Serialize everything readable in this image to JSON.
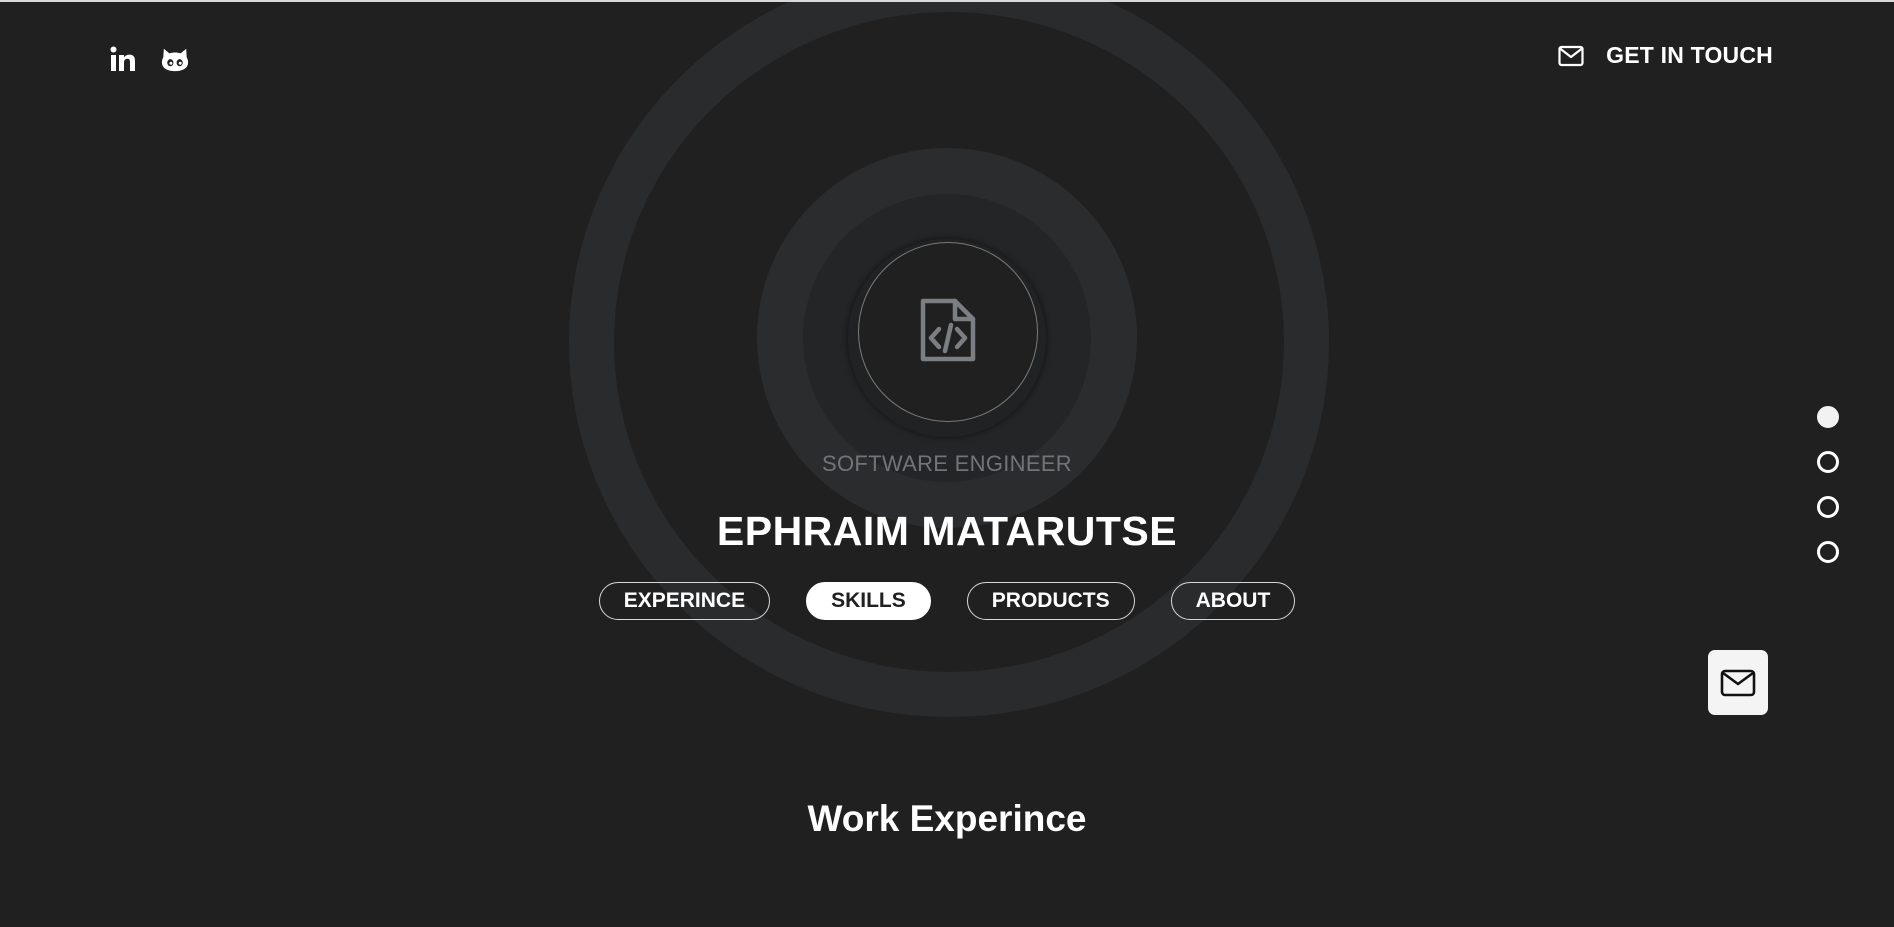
{
  "header": {
    "social_icons": [
      "linkedin-icon",
      "github-icon"
    ],
    "contact_icon": "mail-icon",
    "contact_label": "GET IN TOUCH"
  },
  "hero": {
    "avatar_icon": "code-file-icon",
    "subtitle": "SOFTWARE ENGINEER",
    "name": "EPHRAIM MATARUTSE",
    "nav": [
      {
        "label": "EXPERINCE",
        "active": false
      },
      {
        "label": "SKILLS",
        "active": true
      },
      {
        "label": "PRODUCTS",
        "active": false
      },
      {
        "label": "ABOUT",
        "active": false
      }
    ]
  },
  "side_nav": {
    "dot_count": 4,
    "active_index": 0
  },
  "floating_button": {
    "icon": "mail-icon"
  },
  "section": {
    "title": "Work Experince"
  },
  "colors": {
    "background": "#202020",
    "ring": "#2a2b2d",
    "subtitle": "#727477",
    "text": "#ffffff"
  }
}
